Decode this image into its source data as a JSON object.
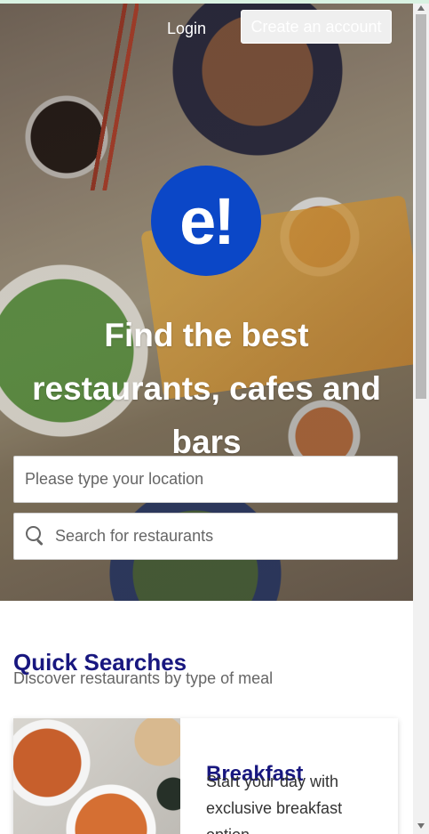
{
  "header": {
    "login": "Login",
    "create_account": "Create an account"
  },
  "hero": {
    "logo": "e!",
    "headline": "Find the best restaurants, cafes and bars",
    "location_placeholder": "Please type your location",
    "restaurant_placeholder": "Search for restaurants"
  },
  "quick_searches": {
    "title": "Quick Searches",
    "subtitle": "Discover restaurants by type of meal",
    "cards": [
      {
        "title": "Breakfast",
        "description": "Start your day with exclusive breakfast option"
      }
    ]
  },
  "colors": {
    "brand_blue": "#0b47c7",
    "section_title": "#18177f"
  },
  "icons": {
    "search": "search-icon"
  }
}
